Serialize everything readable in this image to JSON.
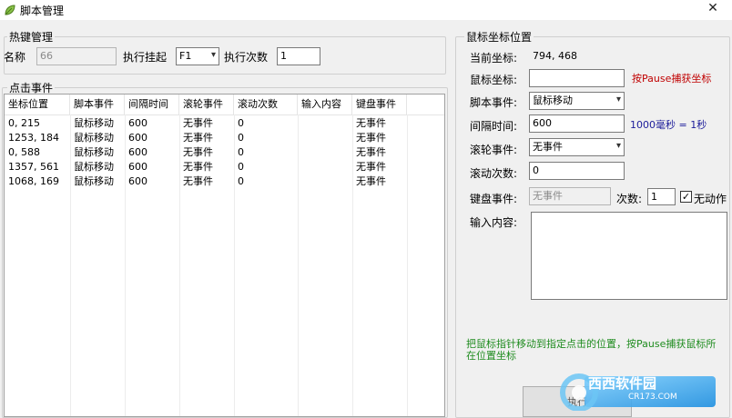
{
  "window": {
    "title": "脚本管理",
    "close_glyph": "✕"
  },
  "hotkey": {
    "legend": "热键管理",
    "name_label": "名称",
    "name_value": "66",
    "trigger_label": "执行挂起",
    "trigger_value": "F1",
    "count_label": "执行次数",
    "count_value": "1"
  },
  "events": {
    "legend": "点击事件",
    "columns": [
      "坐标位置",
      "脚本事件",
      "间隔时间",
      "滚轮事件",
      "滚动次数",
      "输入内容",
      "键盘事件"
    ],
    "rows": [
      [
        "0, 215",
        "鼠标移动",
        "600",
        "无事件",
        "0",
        "",
        "无事件"
      ],
      [
        "1253, 184",
        "鼠标移动",
        "600",
        "无事件",
        "0",
        "",
        "无事件"
      ],
      [
        "0, 588",
        "鼠标移动",
        "600",
        "无事件",
        "0",
        "",
        "无事件"
      ],
      [
        "1357, 561",
        "鼠标移动",
        "600",
        "无事件",
        "0",
        "",
        "无事件"
      ],
      [
        "1068, 169",
        "鼠标移动",
        "600",
        "无事件",
        "0",
        "",
        "无事件"
      ]
    ]
  },
  "mouse": {
    "legend": "鼠标坐标位置",
    "current_label": "当前坐标:",
    "current_value": "794, 468",
    "coord_label": "鼠标坐标:",
    "coord_value": "",
    "coord_hint": "按Pause捕获坐标",
    "script_event_label": "脚本事件:",
    "script_event_value": "鼠标移动",
    "interval_label": "间隔时间:",
    "interval_value": "600",
    "interval_hint": "1000毫秒 = 1秒",
    "wheel_label": "滚轮事件:",
    "wheel_value": "无事件",
    "scroll_count_label": "滚动次数:",
    "scroll_count_value": "0",
    "keyboard_label": "键盘事件:",
    "keyboard_value": "无事件",
    "times_label": "次数:",
    "times_value": "1",
    "no_action_label": "无动作",
    "no_action_checked": "✓",
    "input_label": "输入内容:",
    "input_value": "",
    "help_text": "把鼠标指针移动到指定点击的位置，按Pause捕获鼠标所在位置坐标",
    "run_button": "执行"
  },
  "watermark": {
    "text": "西西软件园",
    "url": "CR173.COM"
  }
}
